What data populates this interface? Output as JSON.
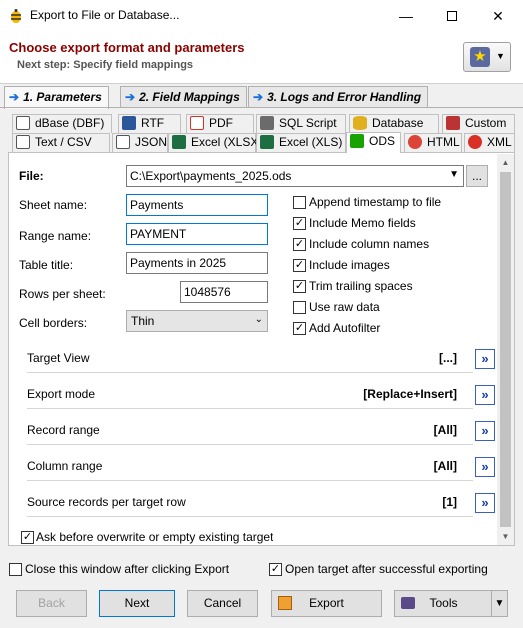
{
  "window": {
    "title": "Export to File or Database..."
  },
  "header": {
    "title": "Choose export format and parameters",
    "subtitle": "Next step: Specify field mappings"
  },
  "steps": [
    {
      "label": "1. Parameters"
    },
    {
      "label": "2. Field Mappings"
    },
    {
      "label": "3. Logs and Error Handling"
    }
  ],
  "format_tabs": {
    "row1": [
      "dBase (DBF)",
      "RTF",
      "PDF",
      "SQL Script",
      "Database",
      "Custom"
    ],
    "row2": [
      "Text / CSV",
      "JSON",
      "Excel (XLSX)",
      "Excel (XLS)",
      "ODS",
      "HTML",
      "XML"
    ],
    "active": "ODS"
  },
  "form": {
    "file_label": "File:",
    "file_value": "C:\\Export\\payments_2025.ods",
    "file_browse": "...",
    "sheet_label": "Sheet name:",
    "sheet_value": "Payments",
    "range_label": "Range name:",
    "range_value": "PAYMENT",
    "table_title_label": "Table title:",
    "table_title_value": "Payments in 2025",
    "rows_label": "Rows per sheet:",
    "rows_value": "1048576",
    "borders_label": "Cell borders:",
    "borders_value": "Thin"
  },
  "options": [
    {
      "label": "Append timestamp to file",
      "checked": false
    },
    {
      "label": "Include Memo fields",
      "checked": true
    },
    {
      "label": "Include column names",
      "checked": true
    },
    {
      "label": "Include images",
      "checked": true
    },
    {
      "label": "Trim trailing spaces",
      "checked": true
    },
    {
      "label": "Use raw data",
      "checked": false
    },
    {
      "label": "Add Autofilter",
      "checked": true
    }
  ],
  "groups": [
    {
      "label": "Target View",
      "value": "[...]"
    },
    {
      "label": "Export mode",
      "value": "[Replace+Insert]"
    },
    {
      "label": "Record range",
      "value": "[All]"
    },
    {
      "label": "Column range",
      "value": "[All]"
    },
    {
      "label": "Source records per target row",
      "value": "[1]"
    }
  ],
  "group_button": "»",
  "ask_overwrite": {
    "label": "Ask before overwrite or empty existing target",
    "checked": true
  },
  "close_after": {
    "label": "Close this window after clicking Export",
    "checked": false
  },
  "open_target": {
    "label": "Open target after successful exporting",
    "checked": true
  },
  "buttons": {
    "back": "Back",
    "next": "Next",
    "cancel": "Cancel",
    "export": "Export",
    "tools": "Tools"
  }
}
